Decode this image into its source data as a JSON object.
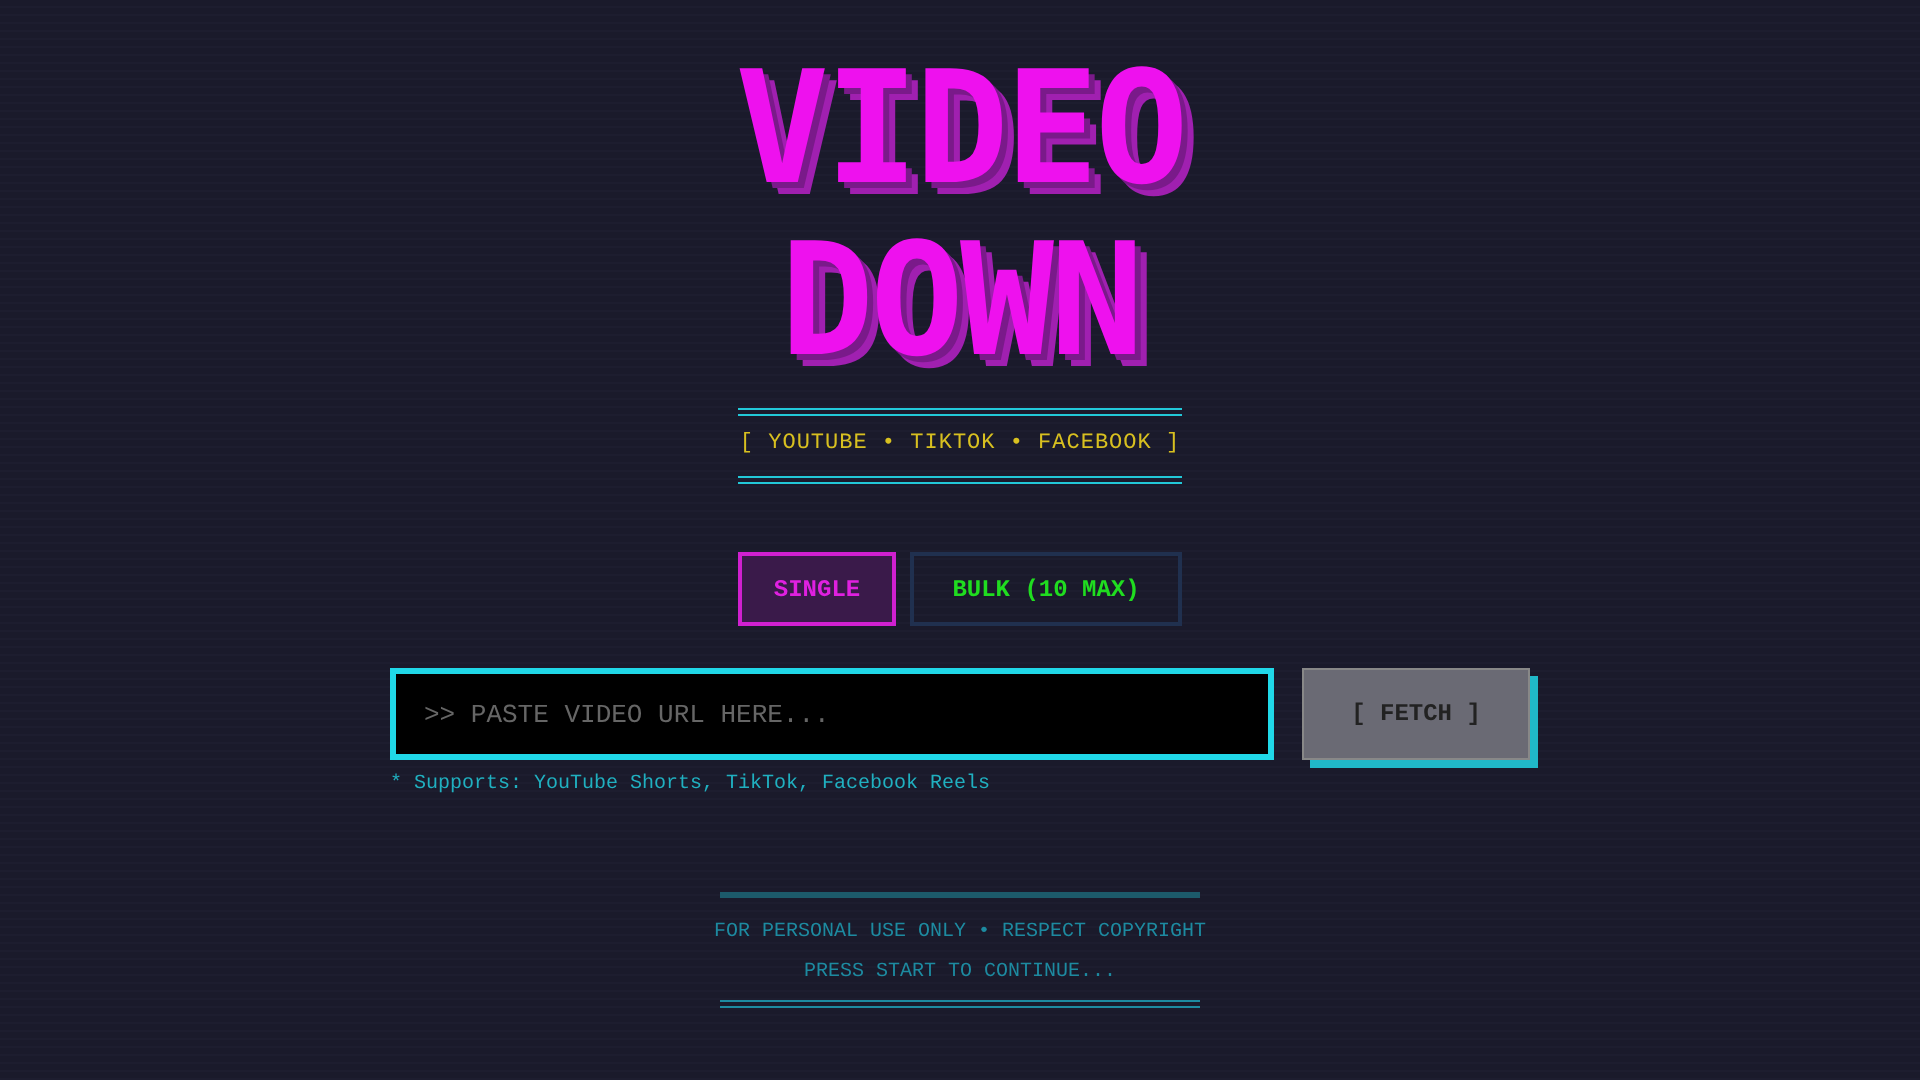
{
  "logo": {
    "lines": [
      "VIDEO",
      "DOWN"
    ]
  },
  "platforms": "[ YOUTUBE • TIKTOK • FACEBOOK ]",
  "tabs": [
    {
      "label": "SINGLE",
      "selected": true
    },
    {
      "label": "BULK (10 MAX)",
      "selected": false
    }
  ],
  "url_field": {
    "placeholder": ">> PASTE VIDEO URL HERE..."
  },
  "fetch_button": {
    "label": "[ FETCH ]",
    "disabled": true
  },
  "supports_note": "* Supports: YouTube Shorts, TikTok, Facebook Reels",
  "footer": {
    "notice": "FOR PERSONAL USE ONLY • RESPECT COPYRIGHT",
    "prompt": "PRESS START TO CONTINUE..."
  }
}
